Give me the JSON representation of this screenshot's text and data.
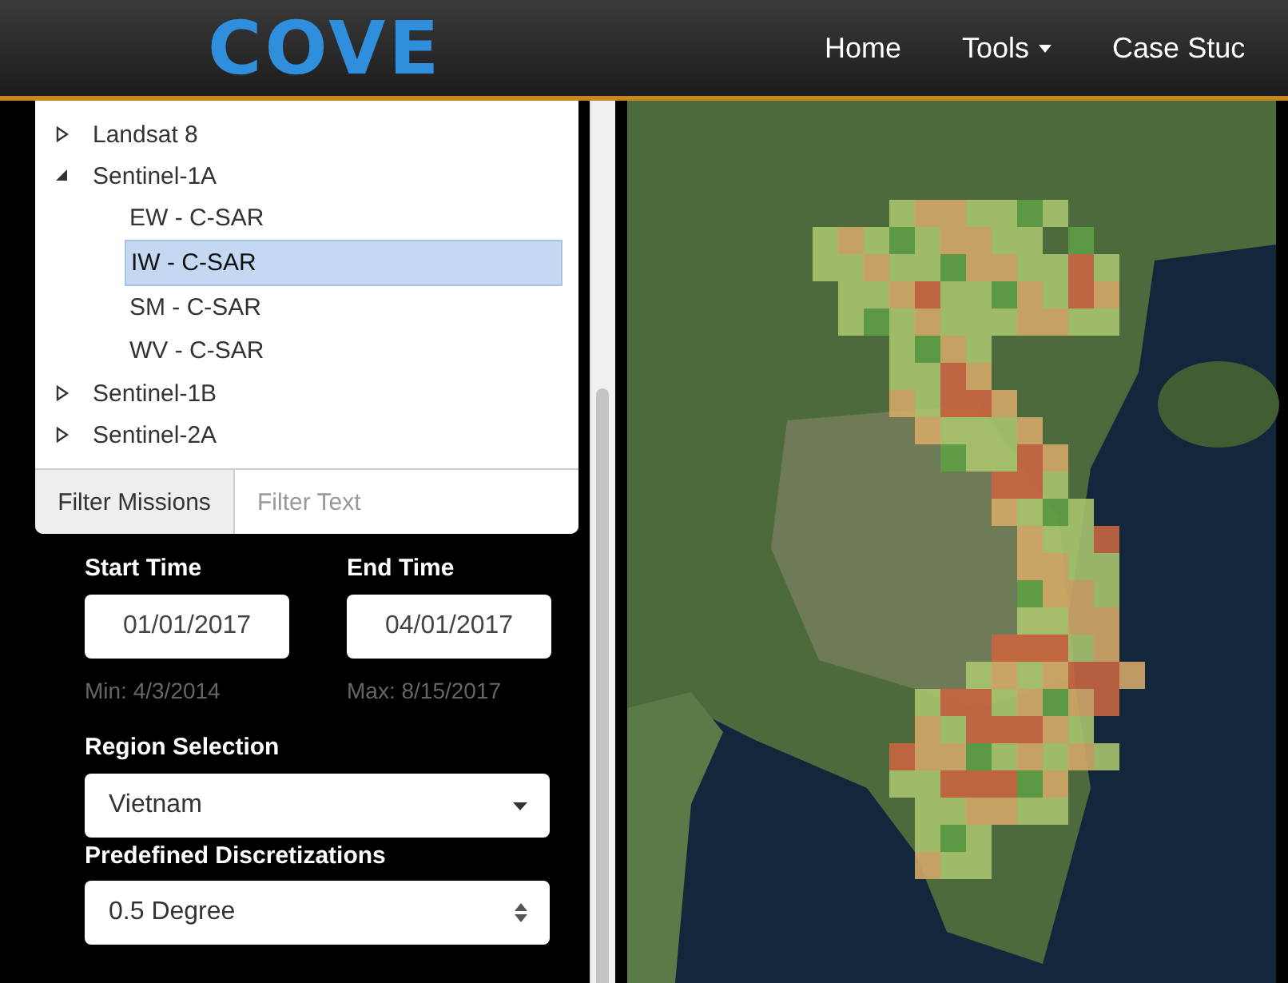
{
  "header": {
    "logo": "COVE",
    "nav": [
      {
        "label": "Home",
        "dropdown": false
      },
      {
        "label": "Tools",
        "dropdown": true
      },
      {
        "label": "Case Stuc",
        "dropdown": false
      }
    ]
  },
  "mission_tree": [
    {
      "label": "Landsat 8",
      "expanded": false,
      "selected": false
    },
    {
      "label": "Sentinel-1A",
      "expanded": true,
      "selected": false,
      "children": [
        {
          "label": "EW - C-SAR",
          "selected": false
        },
        {
          "label": "IW - C-SAR",
          "selected": true
        },
        {
          "label": "SM - C-SAR",
          "selected": false
        },
        {
          "label": "WV - C-SAR",
          "selected": false
        }
      ]
    },
    {
      "label": "Sentinel-1B",
      "expanded": false,
      "selected": false
    },
    {
      "label": "Sentinel-2A",
      "expanded": false,
      "selected": false
    }
  ],
  "filter": {
    "button": "Filter Missions",
    "placeholder": "Filter Text"
  },
  "start_time": {
    "label": "Start Time",
    "value": "01/01/2017",
    "hint": "Min: 4/3/2014"
  },
  "end_time": {
    "label": "End Time",
    "value": "04/01/2017",
    "hint": "Max: 8/15/2017"
  },
  "region": {
    "label": "Region Selection",
    "value": "Vietnam"
  },
  "discretization": {
    "label": "Predefined Discretizations",
    "value": "0.5 Degree"
  }
}
